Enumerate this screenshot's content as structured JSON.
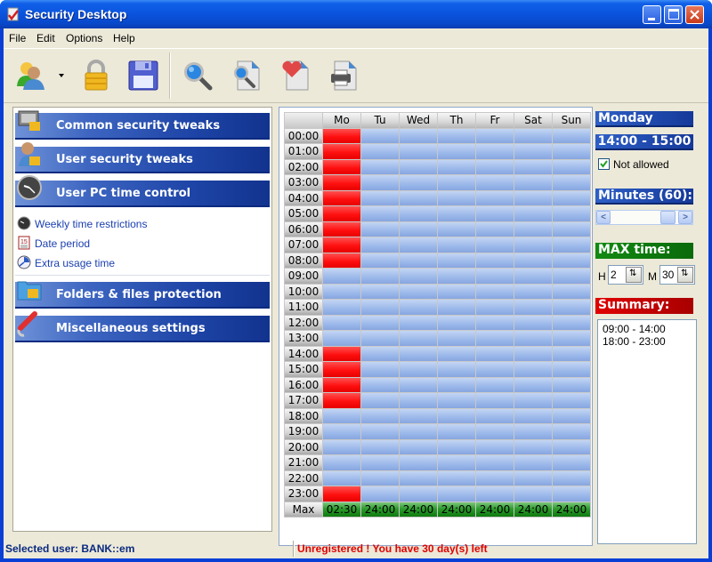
{
  "window": {
    "title": "Security Desktop"
  },
  "menu": [
    "File",
    "Edit",
    "Options",
    "Help"
  ],
  "toolbar": {
    "tools": [
      {
        "icon": "users-icon",
        "label": "Select user"
      },
      {
        "icon": "lock-icon",
        "label": "Lock"
      },
      {
        "icon": "save-icon",
        "label": "Save"
      },
      {
        "icon": "search-icon",
        "label": "Find"
      },
      {
        "icon": "document-search-icon",
        "label": "Find in document"
      },
      {
        "icon": "document-favorite-icon",
        "label": "Favorites"
      },
      {
        "icon": "print-icon",
        "label": "Print"
      }
    ]
  },
  "sidebar": {
    "categories": [
      {
        "label": "Common security tweaks",
        "icon": "monitor-lock-icon"
      },
      {
        "label": "User security tweaks",
        "icon": "user-lock-icon"
      },
      {
        "label": "User PC time control",
        "icon": "clock-icon"
      },
      {
        "label": "Folders & files protection",
        "icon": "folder-lock-icon"
      },
      {
        "label": "Miscellaneous settings",
        "icon": "wrench-icon"
      }
    ],
    "subitems": [
      {
        "label": "Weekly time restrictions",
        "icon": "clock-dark-icon"
      },
      {
        "label": "Date period",
        "icon": "calendar-icon"
      },
      {
        "label": "Extra usage time",
        "icon": "timer-icon"
      }
    ]
  },
  "schedule": {
    "days": [
      "Mo",
      "Tu",
      "Wed",
      "Th",
      "Fr",
      "Sat",
      "Sun"
    ],
    "hours": [
      "00:00",
      "01:00",
      "02:00",
      "03:00",
      "04:00",
      "05:00",
      "06:00",
      "07:00",
      "08:00",
      "09:00",
      "10:00",
      "11:00",
      "12:00",
      "13:00",
      "14:00",
      "15:00",
      "16:00",
      "17:00",
      "18:00",
      "19:00",
      "20:00",
      "21:00",
      "22:00",
      "23:00"
    ],
    "blocked": {
      "Mo": [
        "00:00",
        "01:00",
        "02:00",
        "03:00",
        "04:00",
        "05:00",
        "06:00",
        "07:00",
        "08:00",
        "14:00",
        "15:00",
        "16:00",
        "17:00",
        "23:00"
      ],
      "Tu": [],
      "Wed": [],
      "Th": [],
      "Fr": [],
      "Sat": [],
      "Sun": []
    },
    "max_label": "Max",
    "max_values": [
      "02:30",
      "24:00",
      "24:00",
      "24:00",
      "24:00",
      "24:00",
      "24:00"
    ],
    "colors": {
      "allowed": "#9bb8ea",
      "blocked": "#ff1010",
      "max": "#2d9a2d"
    }
  },
  "details": {
    "day": "Monday",
    "range": "14:00 - 15:00",
    "not_allowed_label": "Not allowed",
    "not_allowed_checked": true,
    "minutes_label": "Minutes (60):",
    "minutes_slider_value": 60,
    "max_time_label": "MAX time:",
    "hours_label": "H",
    "hours_value": "2",
    "minutes_field_label": "M",
    "minutes_value": "30",
    "summary_label": "Summary:",
    "summary_lines": [
      "09:00 - 14:00",
      "18:00 - 23:00"
    ]
  },
  "status": {
    "selected_user": "Selected user: BANK::em",
    "registration": "Unregistered ! You have 30 day(s) left"
  }
}
